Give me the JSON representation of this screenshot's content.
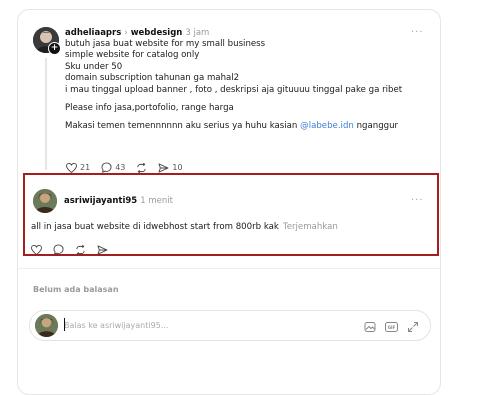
{
  "post": {
    "username": "adheliaaprs",
    "topic": "webdesign",
    "time": "3 jam",
    "lines": [
      "butuh jasa buat website for my small business",
      "simple website for catalog only",
      "Sku under 50",
      "domain subscription tahunan ga mahal2",
      "i mau tinggal upload banner , foto , deskripsi aja gituuuu tinggal pake ga ribet"
    ],
    "para2": "Please info jasa,portofolio, range harga",
    "para3_before": "Makasi temen temennnnnn aku serius ya huhu kasian ",
    "mention": "@labebe.idn",
    "para3_after": " nganggur",
    "likes": "21",
    "comments": "43",
    "shares": "10"
  },
  "reply": {
    "username": "asriwijayanti95",
    "time": "1 menit",
    "text": "all in jasa buat website di idwebhost start from 800rb kak",
    "translate": "Terjemahkan"
  },
  "no_replies": "Belum ada balasan",
  "composer": {
    "placeholder": "Balas ke asriwijayanti95..."
  }
}
